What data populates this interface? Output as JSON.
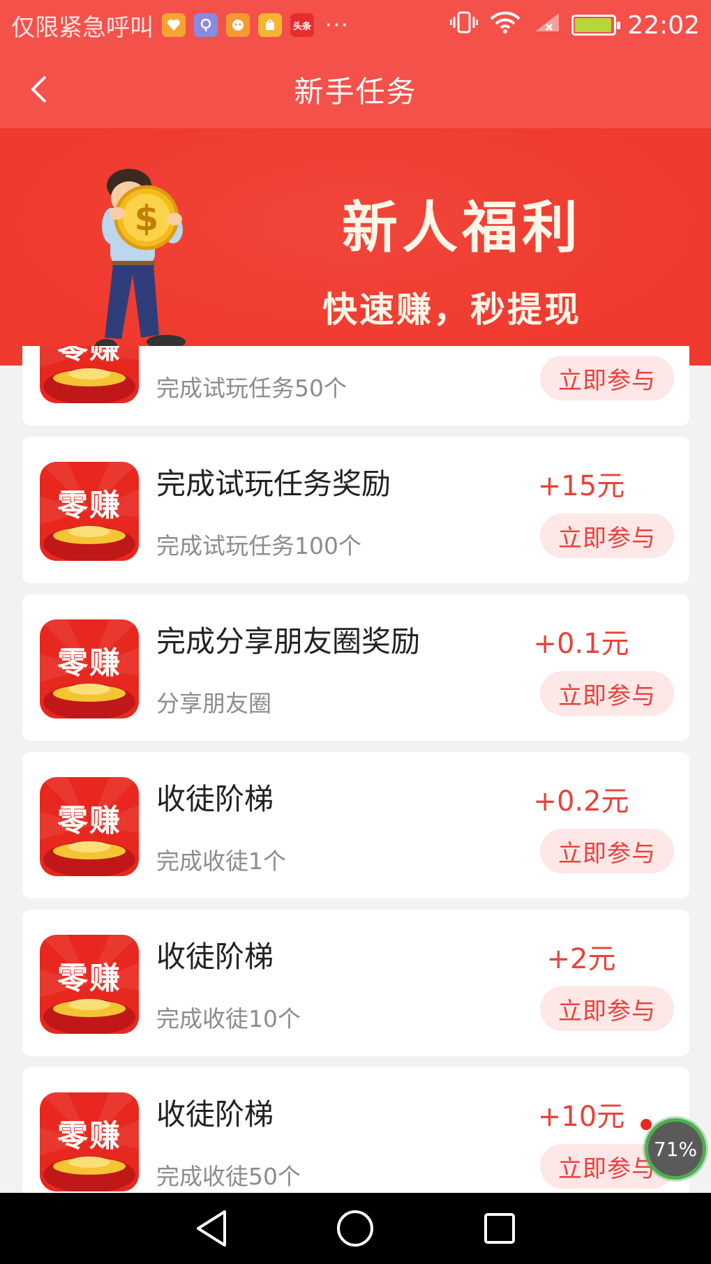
{
  "status_bar": {
    "carrier": "仅限紧急呼叫",
    "notification_icons": [
      "health-app-icon",
      "location-app-icon",
      "game-app-icon",
      "shop-app-icon",
      "toutiao-app-icon"
    ],
    "toutiao_label": "头条",
    "overflow": "···",
    "time": "22:02"
  },
  "nav": {
    "title": "新手任务"
  },
  "banner": {
    "title": "新人福利",
    "subtitle": "快速赚，秒提现"
  },
  "app_icon_text": "零赚",
  "tasks": [
    {
      "title": "",
      "desc": "完成试玩任务50个",
      "reward": "",
      "button": "立即参与"
    },
    {
      "title": "完成试玩任务奖励",
      "desc": "完成试玩任务100个",
      "reward": "+15元",
      "button": "立即参与"
    },
    {
      "title": "完成分享朋友圈奖励",
      "desc": "分享朋友圈",
      "reward": "+0.1元",
      "button": "立即参与"
    },
    {
      "title": "收徒阶梯",
      "desc": "完成收徒1个",
      "reward": "+0.2元",
      "button": "立即参与"
    },
    {
      "title": "收徒阶梯",
      "desc": "完成收徒10个",
      "reward": "+2元",
      "button": "立即参与"
    },
    {
      "title": "收徒阶梯",
      "desc": "完成收徒50个",
      "reward": "+10元",
      "button": "立即参与"
    }
  ],
  "speed_widget": {
    "value": "71%"
  },
  "colors": {
    "header": "#f4514a",
    "banner": "#f03a2e",
    "accent": "#e8423a",
    "button_bg": "#fde7e7"
  }
}
